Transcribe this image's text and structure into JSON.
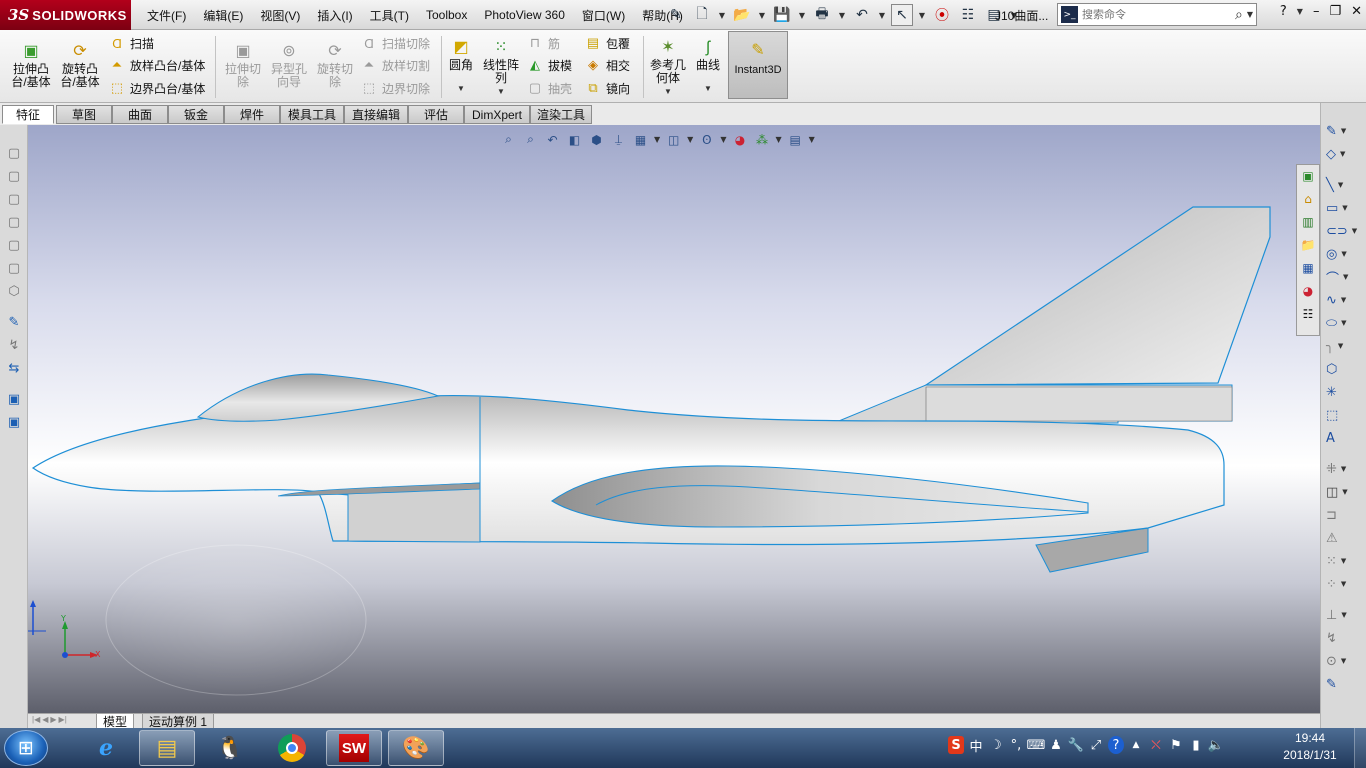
{
  "app": {
    "logo_ds": "3S",
    "logo_text": "SOLIDWORKS",
    "document": "J10曲面..."
  },
  "menu": [
    "文件(F)",
    "编辑(E)",
    "视图(V)",
    "插入(I)",
    "工具(T)",
    "Toolbox",
    "PhotoView 360",
    "窗口(W)",
    "帮助(H)"
  ],
  "search": {
    "placeholder": "搜索命令"
  },
  "ribbon": {
    "extrude_boss": "拉伸凸\n台/基体",
    "revolve_boss": "旋转凸\n台/基体",
    "sweep": "扫描",
    "loft": "放样凸台/基体",
    "boundary": "边界凸台/基体",
    "extrude_cut": "拉伸切\n除",
    "hole_wizard": "异型孔\n向导",
    "revolve_cut": "旋转切\n除",
    "swept_cut": "扫描切除",
    "lofted_cut": "放样切割",
    "boundary_cut": "边界切除",
    "fillet": "圆角",
    "linear_pattern": "线性阵\n列",
    "rib": "筋",
    "draft": "拔模",
    "shell": "抽壳",
    "wrap": "包覆",
    "intersect": "相交",
    "mirror": "镜向",
    "ref_geometry": "参考几\n何体",
    "curves": "曲线",
    "instant3d": "Instant3D"
  },
  "tabs": [
    "特征",
    "草图",
    "曲面",
    "钣金",
    "焊件",
    "模具工具",
    "直接编辑",
    "评估",
    "DimXpert",
    "渲染工具"
  ],
  "model_tabs": [
    "模型",
    "运动算例 1"
  ],
  "triad": {
    "x": "X",
    "y": "Y"
  },
  "clock": {
    "time": "19:44",
    "date": "2018/1/31"
  },
  "colors": {
    "brand": "#b3001b",
    "selection_edge": "#1e8fd6",
    "taskbar": "#2b4a73"
  }
}
